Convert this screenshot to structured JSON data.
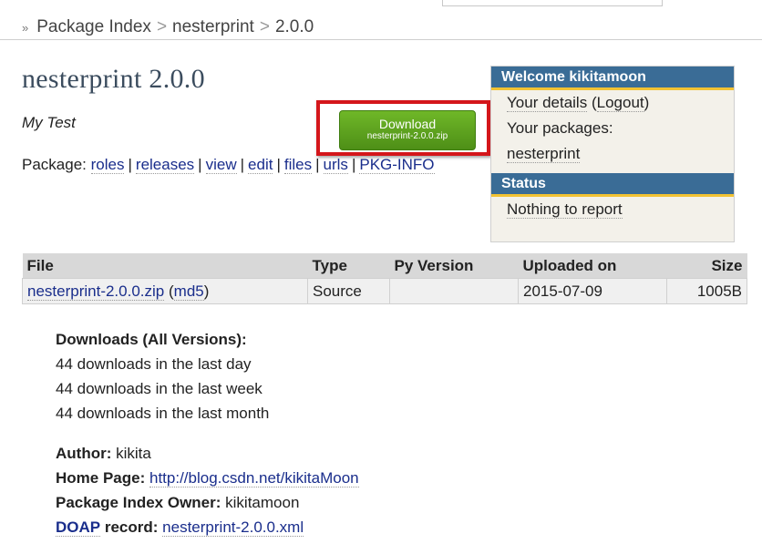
{
  "breadcrumb": {
    "items": [
      "Package Index",
      "nesterprint",
      "2.0.0"
    ],
    "separator": ">"
  },
  "package": {
    "title": "nesterprint 2.0.0",
    "summary": "My Test",
    "links_label": "Package:",
    "links": [
      "roles",
      "releases",
      "view",
      "edit",
      "files",
      "urls",
      "PKG-INFO"
    ]
  },
  "download_button": {
    "label": "Download",
    "filename": "nesterprint-2.0.0.zip",
    "color": "#5fa520",
    "highlight_color": "#d4161b"
  },
  "sidebar": {
    "welcome_title": "Welcome kikitamoon",
    "your_details": "Your details",
    "logout": "Logout",
    "your_packages_label": "Your packages:",
    "packages": [
      "nesterprint"
    ],
    "status_title": "Status",
    "status_text": "Nothing to report",
    "header_color": "#3a6c96",
    "accent_color": "#f2c233"
  },
  "files_table": {
    "columns": [
      "File",
      "Type",
      "Py Version",
      "Uploaded on",
      "Size"
    ],
    "rows": [
      {
        "file": "nesterprint-2.0.0.zip",
        "md5": "md5",
        "type": "Source",
        "py_version": "",
        "uploaded_on": "2015-07-09",
        "size": "1005B"
      }
    ]
  },
  "downloads": {
    "heading": "Downloads (All Versions):",
    "lines": [
      "44 downloads in the last day",
      "44 downloads in the last week",
      "44 downloads in the last month"
    ]
  },
  "meta": {
    "author_label": "Author:",
    "author": "kikita",
    "homepage_label": "Home Page:",
    "homepage": "http://blog.csdn.net/kikitaMoon",
    "owner_label": "Package Index Owner:",
    "owner": "kikitamoon",
    "doap_label": "DOAP",
    "record_label": "record:",
    "doap_file": "nesterprint-2.0.0.xml"
  }
}
